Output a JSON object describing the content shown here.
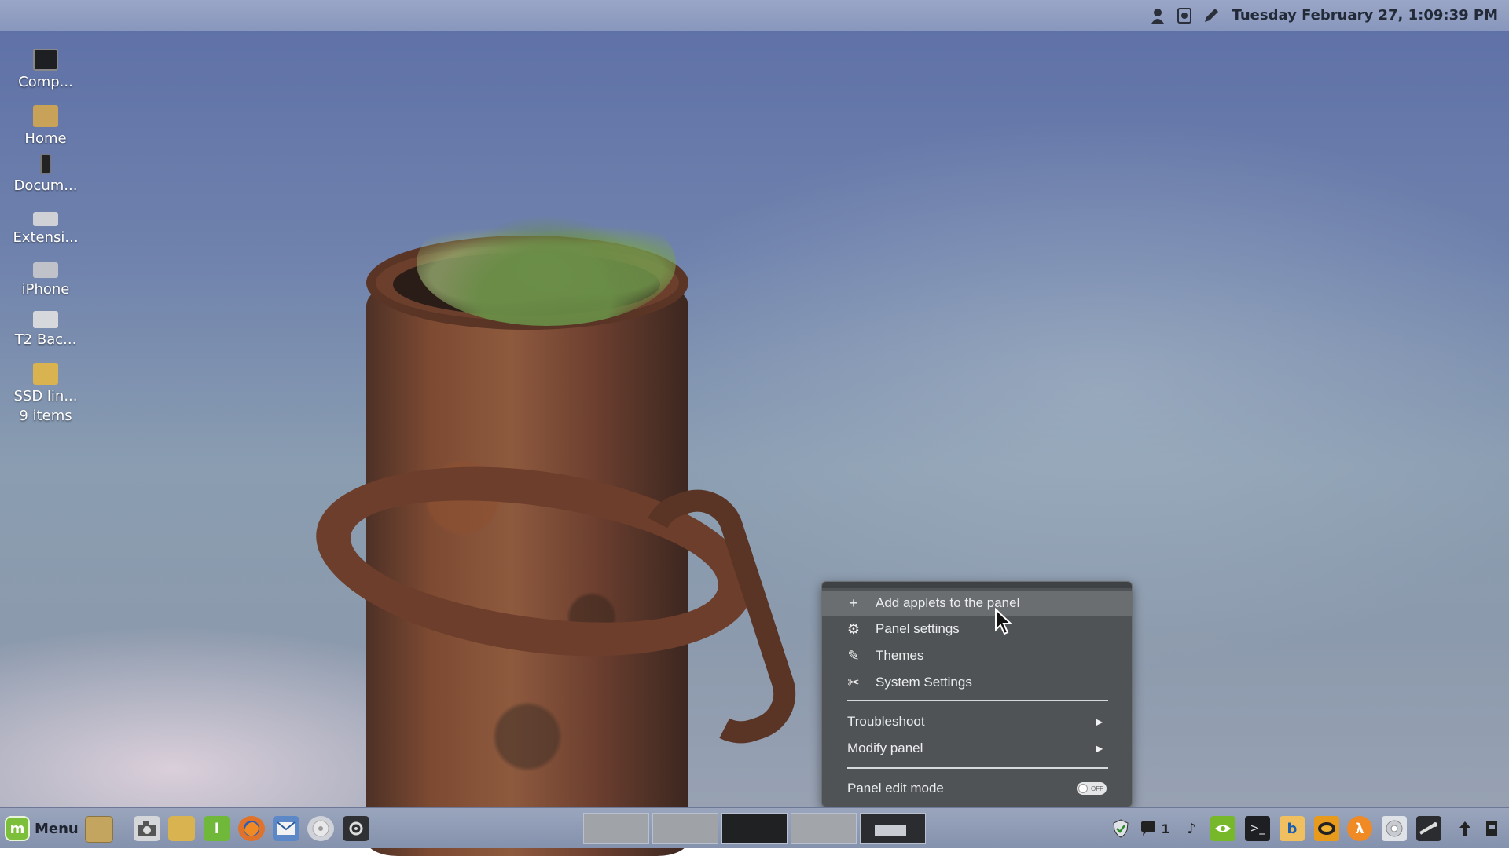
{
  "top_panel": {
    "clock": "Tuesday February 27,  1:09:39 PM",
    "tray_icons": [
      "user-icon",
      "screenshot-icon",
      "pen-icon"
    ]
  },
  "desktop_icons": [
    {
      "label": "Comp...",
      "icon": "monitor-icon"
    },
    {
      "label": "Home",
      "icon": "home-folder-icon"
    },
    {
      "label": "Docum...",
      "icon": "phone-device-icon"
    },
    {
      "label": "Extensi...",
      "icon": "drive-icon"
    },
    {
      "label": "iPhone",
      "icon": "camera-device-icon"
    },
    {
      "label": "T2 Bac...",
      "icon": "usb-drive-icon"
    },
    {
      "label": "SSD lin...",
      "sub": "9 items",
      "icon": "folder-icon"
    }
  ],
  "context_menu": {
    "add_applets": "Add applets to the panel",
    "panel_settings": "Panel settings",
    "themes": "Themes",
    "system_settings": "System Settings",
    "troubleshoot": "Troubleshoot",
    "modify_panel": "Modify panel",
    "panel_edit_mode": "Panel edit mode",
    "toggle_state": "OFF"
  },
  "bottom_panel": {
    "menu_label": "Menu",
    "mint_glyph": "m",
    "chat_count": "1"
  },
  "colors": {
    "menu_bg": "#505355",
    "menu_highlight": "#6b6e71",
    "panel_top": "#9aa6c6",
    "panel_bottom": "#8592ad",
    "mint_green": "#7bbf3a"
  }
}
